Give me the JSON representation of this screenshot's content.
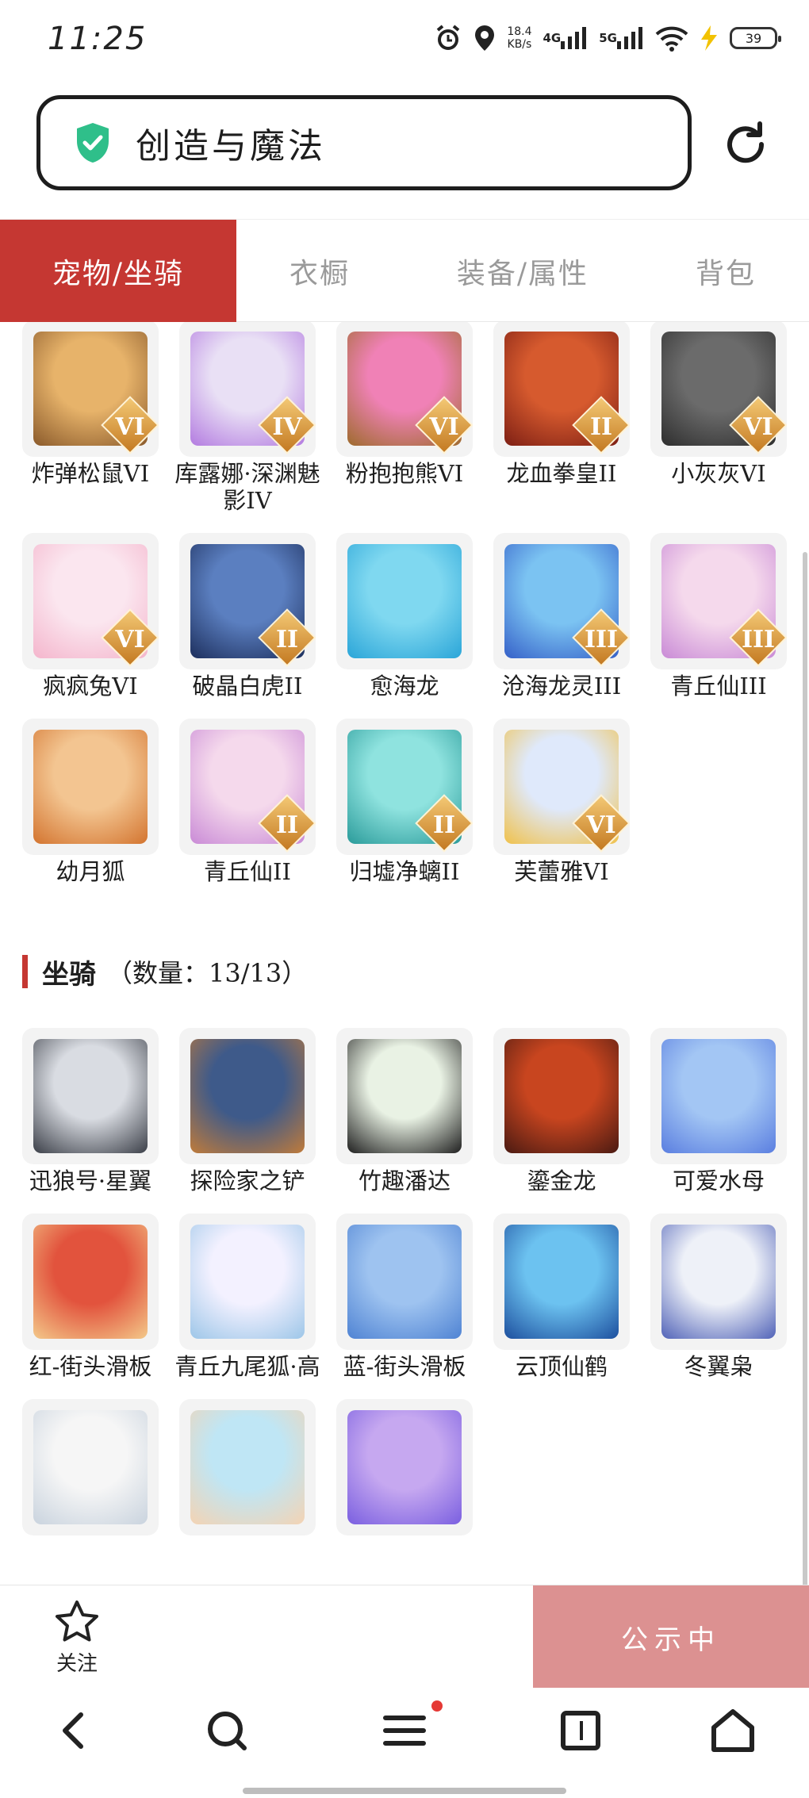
{
  "status_bar": {
    "time": "11:25",
    "net_speed_value": "18.4",
    "net_speed_unit": "KB/s",
    "signal_1": "4G",
    "signal_2": "5G",
    "battery": "39"
  },
  "search": {
    "text": "创造与魔法"
  },
  "tabs": [
    {
      "label": "宠物/坐骑",
      "active": true
    },
    {
      "label": "衣橱",
      "active": false
    },
    {
      "label": "装备/属性",
      "active": false
    },
    {
      "label": "背包",
      "active": false
    }
  ],
  "pets": [
    {
      "name": "炸弹松鼠VI",
      "badge": "VI",
      "icon": "squirrel"
    },
    {
      "name": "库露娜·深渊魅影IV",
      "badge": "IV",
      "icon": "siren"
    },
    {
      "name": "粉抱抱熊VI",
      "badge": "VI",
      "icon": "pink-bear"
    },
    {
      "name": "龙血拳皇II",
      "badge": "II",
      "icon": "dragon-fist"
    },
    {
      "name": "小灰灰VI",
      "badge": "VI",
      "icon": "grey-wolf"
    },
    {
      "name": "疯疯兔VI",
      "badge": "VI",
      "icon": "rabbit"
    },
    {
      "name": "破晶白虎II",
      "badge": "II",
      "icon": "white-tiger"
    },
    {
      "name": "愈海龙",
      "badge": "",
      "icon": "sea-dragon"
    },
    {
      "name": "沧海龙灵III",
      "badge": "III",
      "icon": "dragon-spirit"
    },
    {
      "name": "青丘仙III",
      "badge": "III",
      "icon": "fox-fairy"
    },
    {
      "name": "幼月狐",
      "badge": "",
      "icon": "moon-fox"
    },
    {
      "name": "青丘仙II",
      "badge": "II",
      "icon": "fox-fairy"
    },
    {
      "name": "归墟净螭II",
      "badge": "II",
      "icon": "jade-dragon"
    },
    {
      "name": "芙蕾雅VI",
      "badge": "VI",
      "icon": "freya"
    }
  ],
  "mount_section": {
    "title": "坐骑",
    "count_label": "（数量：13/13）"
  },
  "mounts": [
    {
      "name": "迅狼号·星翼",
      "icon": "mecha-wolf"
    },
    {
      "name": "探险家之铲",
      "icon": "shovel"
    },
    {
      "name": "竹趣潘达",
      "icon": "panda"
    },
    {
      "name": "鎏金龙",
      "icon": "gold-dragon"
    },
    {
      "name": "可爱水母",
      "icon": "jellyfish"
    },
    {
      "name": "红-街头滑板",
      "icon": "red-skateboard"
    },
    {
      "name": "青丘九尾狐·高",
      "icon": "nine-tail-fox"
    },
    {
      "name": "蓝-街头滑板",
      "icon": "blue-skateboard"
    },
    {
      "name": "云顶仙鹤",
      "icon": "crane"
    },
    {
      "name": "冬翼枭",
      "icon": "owl"
    },
    {
      "name": "",
      "icon": "white-cat"
    },
    {
      "name": "",
      "icon": "sheep-girl"
    },
    {
      "name": "",
      "icon": "heart-wings"
    }
  ],
  "action_bar": {
    "follow_label": "关注",
    "notice_button": "公示中"
  },
  "colors": {
    "accent": "#c53732",
    "notice": "#dc9191"
  }
}
